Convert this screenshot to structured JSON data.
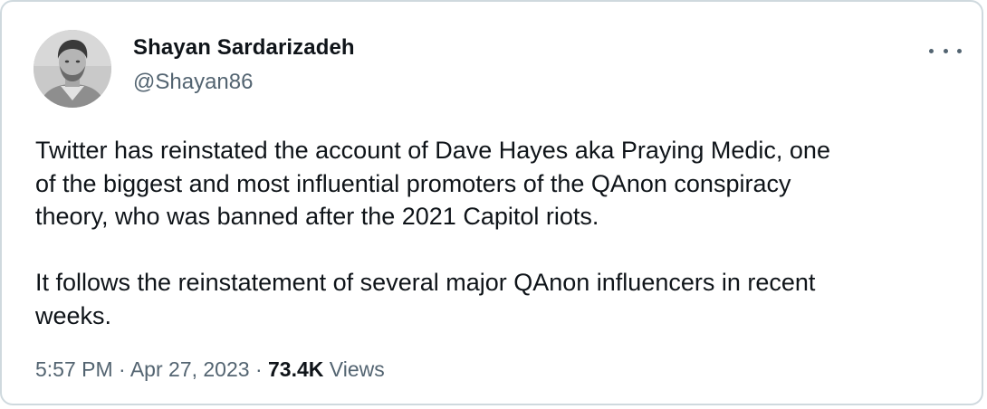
{
  "tweet": {
    "author": {
      "name": "Shayan Sardarizadeh",
      "handle": "@Shayan86",
      "avatar_icon": "profile-photo"
    },
    "more_icon": "more-horizontal-icon",
    "text_paragraphs": [
      "Twitter has reinstated the account of Dave Hayes aka Praying Medic, one\nof the biggest and most influential promoters of the QAnon conspiracy\ntheory, who was banned after the 2021 Capitol riots.",
      "It follows the reinstatement of several major QAnon influencers in recent\nweeks."
    ],
    "time": "5:57 PM",
    "separator": "·",
    "date": "Apr 27, 2023",
    "views_count": "73.4K",
    "views_label": "Views"
  },
  "colors": {
    "text_primary": "#0f1419",
    "text_secondary": "#536471",
    "border": "#cfd9de",
    "background": "#ffffff"
  }
}
